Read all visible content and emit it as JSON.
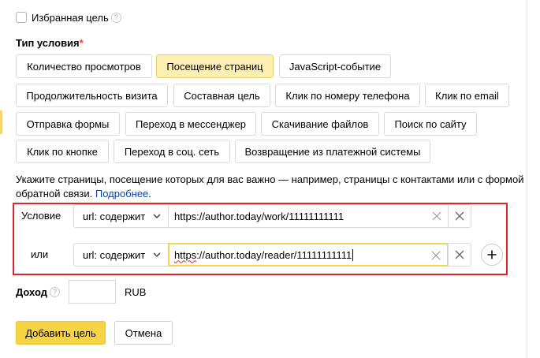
{
  "favorite": {
    "label": "Избранная цель",
    "help": "?"
  },
  "condition_type": {
    "title": "Тип условия",
    "required_mark": "*",
    "options": [
      "Количество просмотров",
      "Посещение страниц",
      "JavaScript-событие",
      "Продолжительность визита",
      "Составная цель",
      "Клик по номеру телефона",
      "Клик по email",
      "Отправка формы",
      "Переход в мессенджер",
      "Скачивание файлов",
      "Поиск по сайту",
      "Клик по кнопке",
      "Переход в соц. сеть",
      "Возвращение из платежной системы"
    ],
    "selected": "Посещение страниц"
  },
  "description": {
    "text": "Укажите страницы, посещение которых для вас важно — например, страницы с контактами или с формой обратной связи.",
    "link": "Подробнее",
    "end": "."
  },
  "conditions": {
    "rows": [
      {
        "label": "Условие",
        "match": "url: содержит",
        "value": "https://author.today/work/11111111111"
      },
      {
        "label": "или",
        "match": "url: содержит",
        "value_prefix": "https",
        "value_rest": "://author.today/reader/11111111111"
      }
    ]
  },
  "income": {
    "label": "Доход",
    "help": "?",
    "value": "",
    "currency": "RUB"
  },
  "actions": {
    "submit": "Добавить цель",
    "cancel": "Отмена"
  },
  "colors": {
    "accent": "#f5d342",
    "selected_bg": "#fdf0b2",
    "highlight_border": "#e0262c",
    "link": "#0044bb"
  }
}
